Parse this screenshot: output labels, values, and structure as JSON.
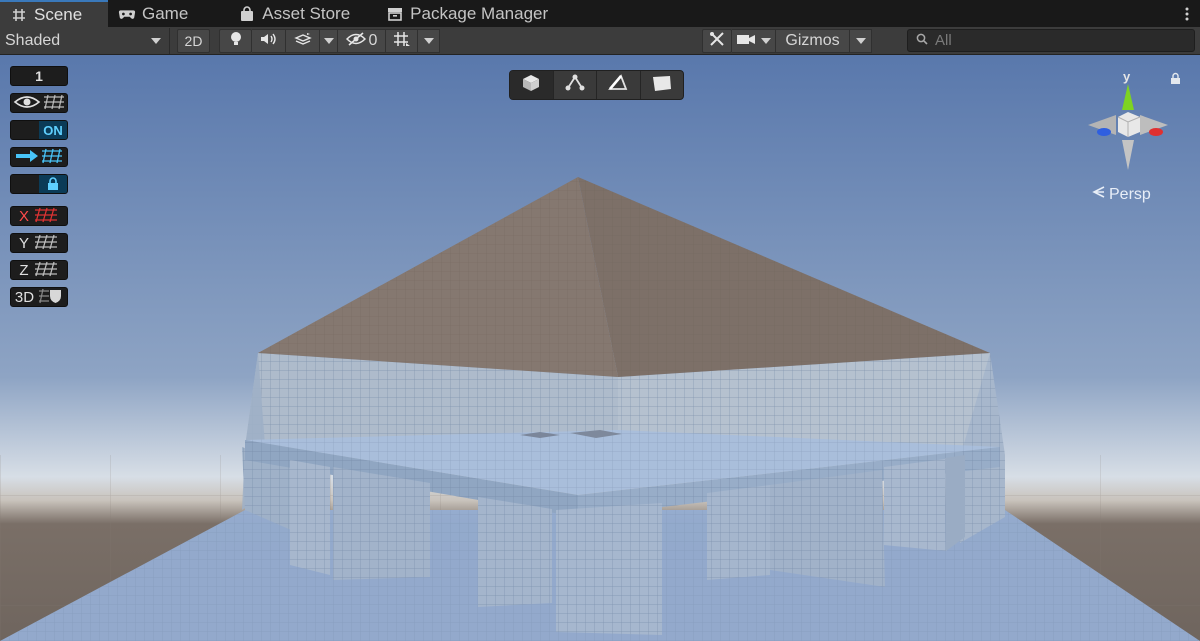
{
  "tabs": [
    {
      "label": "Scene",
      "icon": "grid-icon",
      "active": true
    },
    {
      "label": "Game",
      "icon": "gamepad-icon",
      "active": false
    },
    {
      "label": "Asset Store",
      "icon": "bag-icon",
      "active": false
    },
    {
      "label": "Package Manager",
      "icon": "package-icon",
      "active": false
    }
  ],
  "toolbar": {
    "shading_mode": "Shaded",
    "toggle_2d": "2D",
    "hidden_count": "0",
    "gizmos_label": "Gizmos",
    "search_placeholder": "All"
  },
  "grid_tools": {
    "increment": "1",
    "snap_toggle": "ON",
    "axis_x": "X",
    "axis_y": "Y",
    "axis_z": "Z",
    "label_3d": "3D"
  },
  "orientation": {
    "axis_label": "y",
    "projection": "Persp"
  },
  "colors": {
    "accent": "#3a79bb",
    "snap_highlight": "#5fd0ff",
    "axis_x": "#e03030",
    "axis_y": "#7ed321",
    "axis_z": "#2f5fe0",
    "sky_top": "#5c7db0",
    "horizon": "#cfd9e4",
    "ground": "#6e655e"
  }
}
